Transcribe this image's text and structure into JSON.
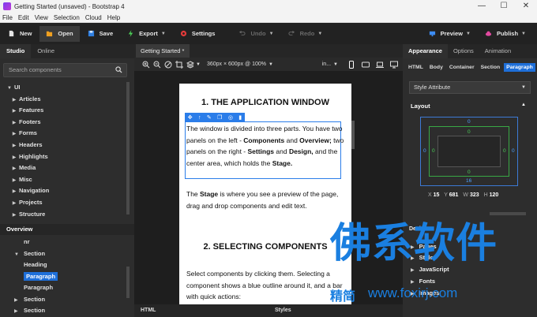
{
  "window": {
    "title": "Getting Started (unsaved) - Bootstrap 4",
    "minimize_glyph": "—",
    "maximize_glyph": "☐",
    "close_glyph": "✕"
  },
  "menu": [
    "File",
    "Edit",
    "View",
    "Selection",
    "Cloud",
    "Help"
  ],
  "toolbar": {
    "new": "New",
    "open": "Open",
    "save": "Save",
    "export": "Export",
    "settings": "Settings",
    "undo": "Undo",
    "redo": "Redo",
    "preview": "Preview",
    "publish": "Publish"
  },
  "left": {
    "tabs": [
      "Studio",
      "Online"
    ],
    "search_placeholder": "Search components",
    "root": "UI",
    "categories": [
      "Articles",
      "Features",
      "Footers",
      "Forms",
      "Headers",
      "Highlights",
      "Media",
      "Misc",
      "Navigation",
      "Projects",
      "Structure"
    ],
    "overview_title": "Overview",
    "overview": [
      {
        "label": "nr",
        "depth": 2,
        "arrow": ""
      },
      {
        "label": "Section",
        "depth": 1,
        "arrow": "▼"
      },
      {
        "label": "Heading",
        "depth": 2,
        "arrow": ""
      },
      {
        "label": "Paragraph",
        "depth": 2,
        "arrow": "",
        "selected": true
      },
      {
        "label": "Paragraph",
        "depth": 2,
        "arrow": ""
      },
      {
        "label": "Section",
        "depth": 1,
        "arrow": "▶"
      },
      {
        "label": "Section",
        "depth": 1,
        "arrow": "▶"
      }
    ]
  },
  "center": {
    "tab": "Getting Started *",
    "viewport": "360px × 600px @ 100%",
    "device_label": "in...",
    "heading1": "1. THE APPLICATION WINDOW",
    "para1_parts": [
      {
        "t": "The window is divided into three parts. You have two panels on the left - ",
        "b": false
      },
      {
        "t": "Components",
        "b": true
      },
      {
        "t": " and ",
        "b": false
      },
      {
        "t": "Overview;",
        "b": true
      },
      {
        "t": " two panels on the right - ",
        "b": false
      },
      {
        "t": "Settings",
        "b": true
      },
      {
        "t": " and ",
        "b": false
      },
      {
        "t": "Design,",
        "b": true
      },
      {
        "t": " and the center area, which holds the ",
        "b": false
      },
      {
        "t": "Stage.",
        "b": true
      }
    ],
    "para2_parts": [
      {
        "t": "The ",
        "b": false
      },
      {
        "t": "Stage",
        "b": true
      },
      {
        "t": " is where you see a preview of the page, drag and drop components and edit text.",
        "b": false
      }
    ],
    "heading2": "2. SELECTING COMPONENTS",
    "para3": "Select components by clicking them. Selecting a component shows a blue outline around it, and a bar with quick actions:",
    "bottom_tabs": [
      "HTML",
      "Styles"
    ]
  },
  "right": {
    "tabs": [
      "Appearance",
      "Options",
      "Animation"
    ],
    "subtabs": [
      "HTML",
      "Body",
      "Container",
      "Section",
      "Paragraph"
    ],
    "style_attribute": "Style Attribute",
    "layout_title": "Layout",
    "box": {
      "margin_top": "0",
      "margin_right": "0",
      "margin_bottom": "16",
      "margin_left": "0",
      "padding_top": "0",
      "padding_right": "0",
      "padding_bottom": "0",
      "padding_left": "0"
    },
    "coords": {
      "x_label": "X",
      "x": "15",
      "y_label": "Y",
      "y": "681",
      "w_label": "W",
      "w": "323",
      "h_label": "H",
      "h": "120"
    },
    "design_title": "Design",
    "design_items": [
      "Pages",
      "Styles",
      "JavaScript",
      "Fonts",
      "Images"
    ]
  },
  "watermark": {
    "main": "佛系软件",
    "sub_cn": "精简",
    "url": "www.foxirj.com"
  },
  "colors": {
    "accent": "#1e6fd9",
    "toolbar_bg": "#222222",
    "panel_bg": "#2d2d2d",
    "watermark": "#1a7fe0"
  }
}
